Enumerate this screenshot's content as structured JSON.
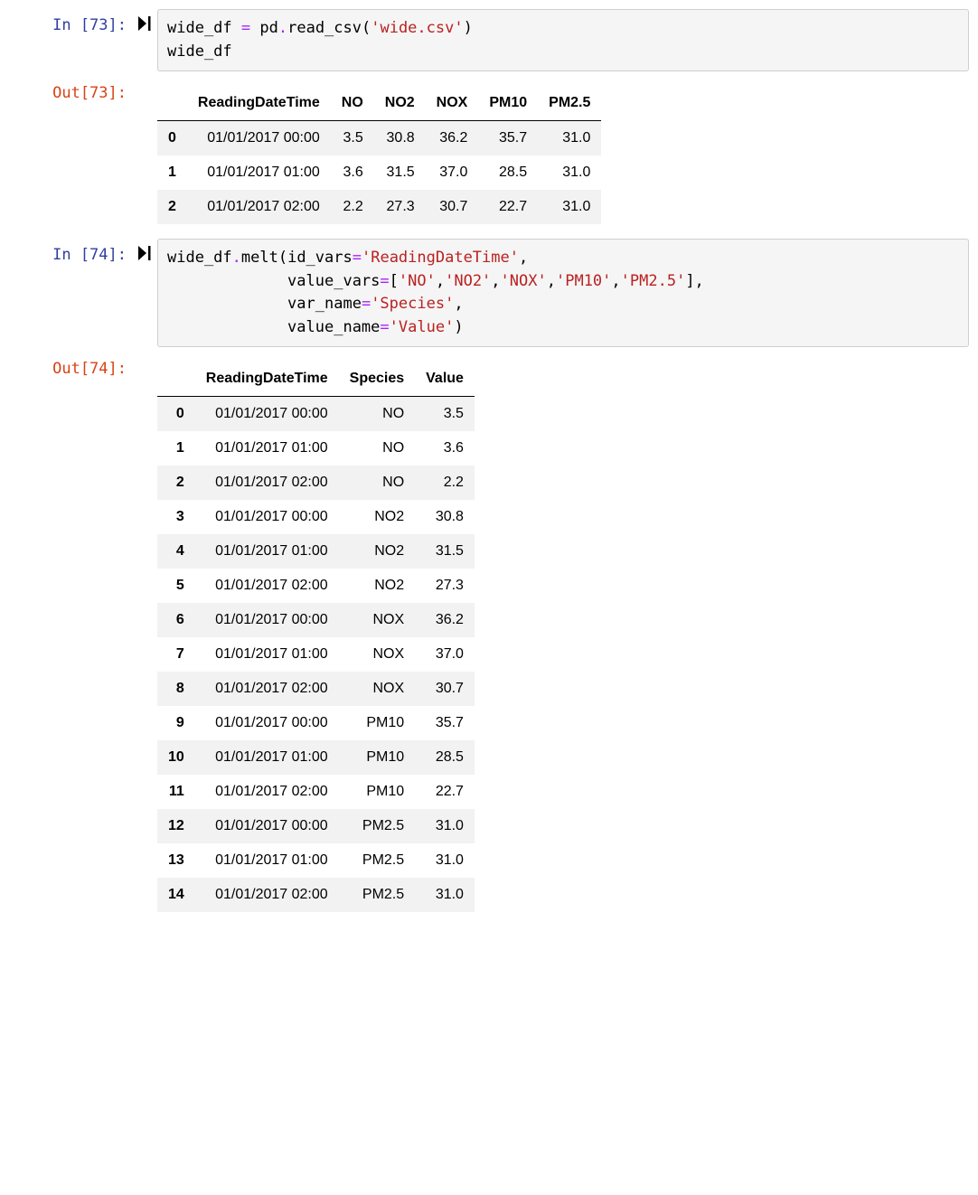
{
  "cells": [
    {
      "in_prompt": "In [73]:",
      "out_prompt": "Out[73]:",
      "code_tokens": [
        {
          "t": "wide_df ",
          "c": "code-plain"
        },
        {
          "t": "=",
          "c": "code-op"
        },
        {
          "t": " pd",
          "c": "code-plain"
        },
        {
          "t": ".",
          "c": "code-op"
        },
        {
          "t": "read_csv(",
          "c": "code-plain"
        },
        {
          "t": "'wide.csv'",
          "c": "code-str"
        },
        {
          "t": ")\nwide_df",
          "c": "code-plain"
        }
      ],
      "table": {
        "columns": [
          "ReadingDateTime",
          "NO",
          "NO2",
          "NOX",
          "PM10",
          "PM2.5"
        ],
        "index": [
          "0",
          "1",
          "2"
        ],
        "rows": [
          [
            "01/01/2017 00:00",
            "3.5",
            "30.8",
            "36.2",
            "35.7",
            "31.0"
          ],
          [
            "01/01/2017 01:00",
            "3.6",
            "31.5",
            "37.0",
            "28.5",
            "31.0"
          ],
          [
            "01/01/2017 02:00",
            "2.2",
            "27.3",
            "30.7",
            "22.7",
            "31.0"
          ]
        ]
      }
    },
    {
      "in_prompt": "In [74]:",
      "out_prompt": "Out[74]:",
      "code_tokens": [
        {
          "t": "wide_df",
          "c": "code-plain"
        },
        {
          "t": ".",
          "c": "code-op"
        },
        {
          "t": "melt(id_vars",
          "c": "code-plain"
        },
        {
          "t": "=",
          "c": "code-op"
        },
        {
          "t": "'ReadingDateTime'",
          "c": "code-str"
        },
        {
          "t": ",\n             value_vars",
          "c": "code-plain"
        },
        {
          "t": "=",
          "c": "code-op"
        },
        {
          "t": "[",
          "c": "code-plain"
        },
        {
          "t": "'NO'",
          "c": "code-str"
        },
        {
          "t": ",",
          "c": "code-plain"
        },
        {
          "t": "'NO2'",
          "c": "code-str"
        },
        {
          "t": ",",
          "c": "code-plain"
        },
        {
          "t": "'NOX'",
          "c": "code-str"
        },
        {
          "t": ",",
          "c": "code-plain"
        },
        {
          "t": "'PM10'",
          "c": "code-str"
        },
        {
          "t": ",",
          "c": "code-plain"
        },
        {
          "t": "'PM2.5'",
          "c": "code-str"
        },
        {
          "t": "],\n             var_name",
          "c": "code-plain"
        },
        {
          "t": "=",
          "c": "code-op"
        },
        {
          "t": "'Species'",
          "c": "code-str"
        },
        {
          "t": ",\n             value_name",
          "c": "code-plain"
        },
        {
          "t": "=",
          "c": "code-op"
        },
        {
          "t": "'Value'",
          "c": "code-str"
        },
        {
          "t": ")",
          "c": "code-plain"
        }
      ],
      "table": {
        "columns": [
          "ReadingDateTime",
          "Species",
          "Value"
        ],
        "index": [
          "0",
          "1",
          "2",
          "3",
          "4",
          "5",
          "6",
          "7",
          "8",
          "9",
          "10",
          "11",
          "12",
          "13",
          "14"
        ],
        "rows": [
          [
            "01/01/2017 00:00",
            "NO",
            "3.5"
          ],
          [
            "01/01/2017 01:00",
            "NO",
            "3.6"
          ],
          [
            "01/01/2017 02:00",
            "NO",
            "2.2"
          ],
          [
            "01/01/2017 00:00",
            "NO2",
            "30.8"
          ],
          [
            "01/01/2017 01:00",
            "NO2",
            "31.5"
          ],
          [
            "01/01/2017 02:00",
            "NO2",
            "27.3"
          ],
          [
            "01/01/2017 00:00",
            "NOX",
            "36.2"
          ],
          [
            "01/01/2017 01:00",
            "NOX",
            "37.0"
          ],
          [
            "01/01/2017 02:00",
            "NOX",
            "30.7"
          ],
          [
            "01/01/2017 00:00",
            "PM10",
            "35.7"
          ],
          [
            "01/01/2017 01:00",
            "PM10",
            "28.5"
          ],
          [
            "01/01/2017 02:00",
            "PM10",
            "22.7"
          ],
          [
            "01/01/2017 00:00",
            "PM2.5",
            "31.0"
          ],
          [
            "01/01/2017 01:00",
            "PM2.5",
            "31.0"
          ],
          [
            "01/01/2017 02:00",
            "PM2.5",
            "31.0"
          ]
        ]
      }
    }
  ]
}
